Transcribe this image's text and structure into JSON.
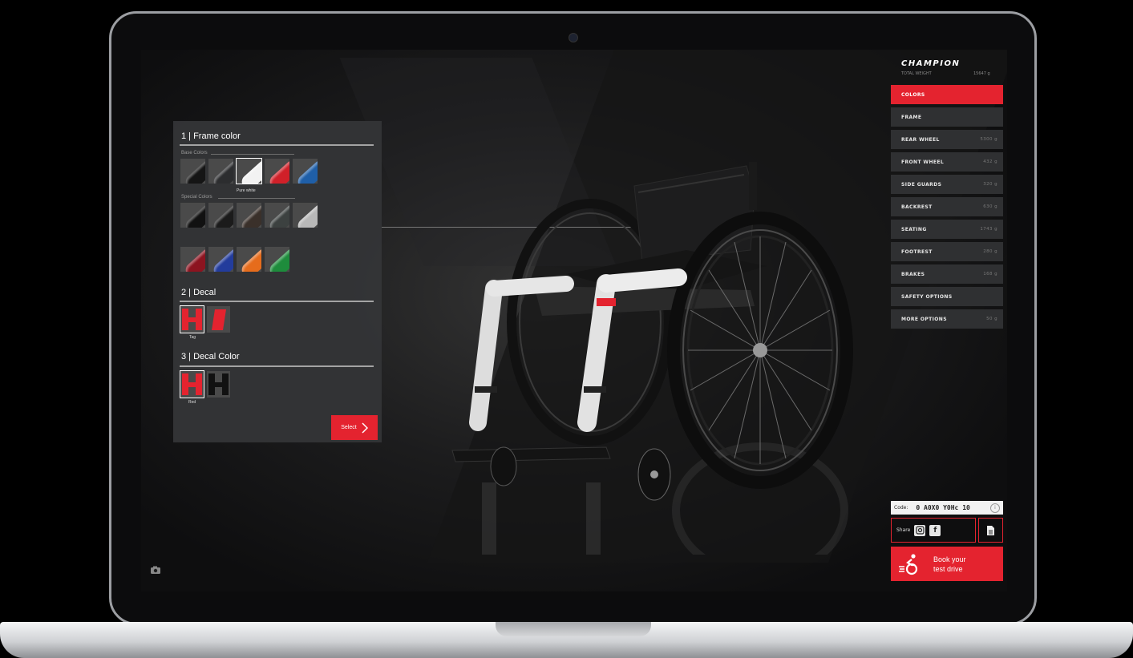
{
  "panel": {
    "sections": [
      {
        "title": "1 | Frame color"
      },
      {
        "title": "2 | Decal"
      },
      {
        "title": "3 | Decal Color"
      }
    ],
    "base_colors_label": "Base Colors",
    "special_colors_label": "Special Colors",
    "base_swatches": [
      {
        "color": "#151515",
        "icon": "black-frame-swatch"
      },
      {
        "color": "#2c2d2f",
        "icon": "anthracite-frame-swatch"
      },
      {
        "color": "#f2f2f2",
        "icon": "pure-white-frame-swatch"
      },
      {
        "color": "#d02029",
        "icon": "red-frame-swatch"
      },
      {
        "color": "#1f5fa8",
        "icon": "blue-frame-swatch"
      }
    ],
    "selected_swatch_caption": "Pure white",
    "special_swatches_row1": [
      {
        "color": "#111111"
      },
      {
        "color": "#1b1b1b"
      },
      {
        "color": "#3a302a"
      },
      {
        "color": "#3c4140"
      },
      {
        "color": "#b8b8b8"
      }
    ],
    "special_swatches_row2": [
      {
        "color": "#8c1420"
      },
      {
        "color": "#233c9c"
      },
      {
        "color": "#e66c1c"
      },
      {
        "color": "#1e8c3c"
      }
    ],
    "decal_caption": "Tag",
    "decal_color_caption": "Red",
    "select_label": "Select"
  },
  "sidebar": {
    "brand": "CHAMPION",
    "total_weight_label": "TOTAL WEIGHT",
    "total_weight_value": "15647 g",
    "items": [
      {
        "label": "COLORS",
        "weight": "",
        "active": true
      },
      {
        "label": "FRAME",
        "weight": ""
      },
      {
        "label": "REAR WHEEL",
        "weight": "5300 g"
      },
      {
        "label": "FRONT WHEEL",
        "weight": "432 g"
      },
      {
        "label": "SIDE GUARDS",
        "weight": "320 g"
      },
      {
        "label": "BACKREST",
        "weight": "630 g"
      },
      {
        "label": "SEATING",
        "weight": "1743 g"
      },
      {
        "label": "FOOTREST",
        "weight": "280 g"
      },
      {
        "label": "BRAKES",
        "weight": "168 g"
      },
      {
        "label": "SAFETY OPTIONS",
        "weight": ""
      },
      {
        "label": "MORE OPTIONS",
        "weight": "50 g"
      }
    ],
    "code_label": "Code:",
    "code_value": "0 A0X0 Y0Hc 10",
    "share_label": "Share",
    "book_line1": "Book your",
    "book_line2": "test drive"
  },
  "colors": {
    "accent": "#e4232f",
    "panel": "#343537",
    "menu_item": "#2f3032"
  }
}
